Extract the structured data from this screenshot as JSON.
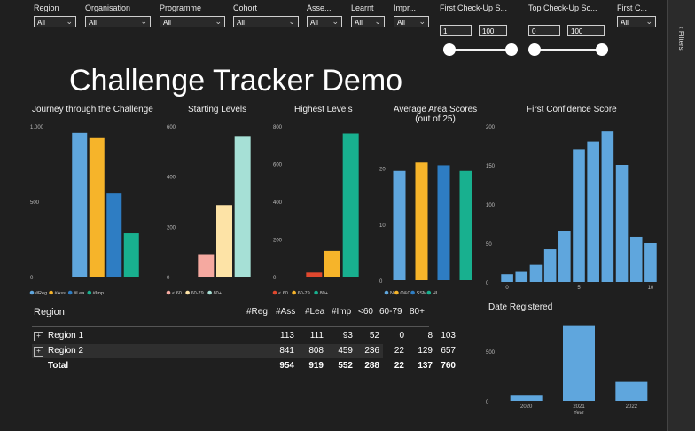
{
  "slicers": [
    {
      "label": "Region",
      "value": "All"
    },
    {
      "label": "Organisation",
      "value": "All"
    },
    {
      "label": "Programme",
      "value": "All"
    },
    {
      "label": "Cohort",
      "value": "All"
    },
    {
      "label": "Asse...",
      "value": "All"
    },
    {
      "label": "Learnt",
      "value": "All"
    },
    {
      "label": "Impr...",
      "value": "All"
    },
    {
      "label": "First C...",
      "value": "All"
    }
  ],
  "range_slicers": [
    {
      "label": "First Check-Up S...",
      "min_value": "1",
      "max_value": "100"
    },
    {
      "label": "Top Check-Up Sc...",
      "min_value": "0",
      "max_value": "100"
    }
  ],
  "filters_pane": {
    "label": "Filters"
  },
  "page_title": "Challenge Tracker Demo",
  "table": {
    "title": "Region",
    "columns": [
      "#Reg",
      "#Ass",
      "#Lea",
      "#Imp",
      "<60",
      "60-79",
      "80+"
    ],
    "rows": [
      {
        "label": "Region 1",
        "expand": "+",
        "values": [
          "113",
          "111",
          "93",
          "52",
          "0",
          "8",
          "103"
        ]
      },
      {
        "label": "Region 2",
        "expand": "+",
        "values": [
          "841",
          "808",
          "459",
          "236",
          "22",
          "129",
          "657"
        ]
      }
    ],
    "total": {
      "label": "Total",
      "values": [
        "954",
        "919",
        "552",
        "288",
        "22",
        "137",
        "760"
      ]
    }
  },
  "chart_data": [
    {
      "type": "bar",
      "title": "Journey through the Challenge",
      "categories": [
        "#Reg",
        "#Ass",
        "#Lea",
        "#Imp"
      ],
      "values": [
        954,
        919,
        552,
        288
      ],
      "colors": [
        "#5fa6dd",
        "#f6b42a",
        "#2e7dc3",
        "#18b08f"
      ],
      "ylim": [
        0,
        1000
      ],
      "yticks": [
        "0",
        "500",
        "1,000"
      ],
      "legend": [
        "#Reg",
        "#Ass",
        "#Lea",
        "#Imp"
      ]
    },
    {
      "type": "bar",
      "title": "Starting Levels",
      "categories": [
        "< 60",
        "60-79",
        "80+"
      ],
      "values": [
        90,
        285,
        560
      ],
      "colors": [
        "#f5a9a0",
        "#fde3a6",
        "#a6e0d6"
      ],
      "ylim": [
        0,
        600
      ],
      "yticks": [
        "0",
        "200",
        "400",
        "600"
      ],
      "legend": [
        "< 60",
        "60-79",
        "80+"
      ]
    },
    {
      "type": "bar",
      "title": "Highest Levels",
      "categories": [
        "< 60",
        "60-79",
        "80+"
      ],
      "values": [
        22,
        137,
        760
      ],
      "colors": [
        "#e0482e",
        "#f6b42a",
        "#18b08f"
      ],
      "ylim": [
        0,
        800
      ],
      "yticks": [
        "0",
        "200",
        "400",
        "600",
        "800"
      ],
      "legend": [
        "< 60",
        "60-79",
        "80+"
      ]
    },
    {
      "type": "bar",
      "title": "Average Area Scores (out of 25)",
      "title_lines": [
        "Average Area Scores",
        "(out of 25)"
      ],
      "categories": [
        "N",
        "O&C",
        "SSM",
        "HI"
      ],
      "values": [
        19.5,
        21,
        20.5,
        19.5
      ],
      "colors": [
        "#5fa6dd",
        "#f6b42a",
        "#2e7dc3",
        "#18b08f"
      ],
      "ylim": [
        0,
        25
      ],
      "yticks": [
        "0",
        "10",
        "20"
      ],
      "legend": [
        "N",
        "O&C",
        "SSM",
        "HI"
      ]
    },
    {
      "type": "bar",
      "title": "First Confidence Score",
      "categories": [
        "0",
        "1",
        "2",
        "3",
        "4",
        "5",
        "6",
        "7",
        "8",
        "9",
        "10"
      ],
      "values": [
        10,
        13,
        22,
        42,
        65,
        170,
        180,
        193,
        150,
        58,
        50
      ],
      "colors": [
        "#5fa6dd"
      ],
      "ylim": [
        0,
        200
      ],
      "yticks": [
        "0",
        "50",
        "100",
        "150",
        "200"
      ],
      "xticks": [
        "0",
        "5",
        "10"
      ]
    },
    {
      "type": "bar",
      "title": "Date Registered",
      "categories": [
        "2020",
        "2021",
        "2022"
      ],
      "values": [
        60,
        750,
        190
      ],
      "colors": [
        "#5fa6dd"
      ],
      "ylim": [
        0,
        800
      ],
      "yticks": [
        "0",
        "500"
      ],
      "xlabel": "Year"
    }
  ]
}
